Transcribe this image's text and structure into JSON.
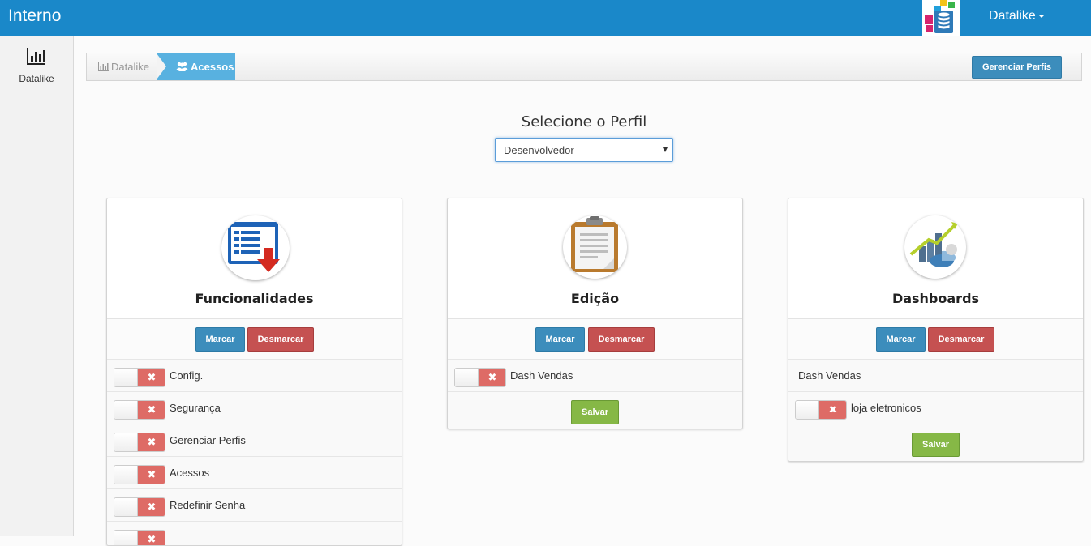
{
  "navbar": {
    "brand": "Interno",
    "user_menu_label": "Datalike"
  },
  "sidebar": {
    "items": [
      {
        "label": "Datalike",
        "icon": "bar-chart-icon"
      }
    ]
  },
  "breadcrumb": {
    "items": [
      {
        "label": "Datalike",
        "icon": "bar-chart-icon"
      },
      {
        "label": "Acessos",
        "icon": "users-icon"
      }
    ],
    "manage_profiles_label": "Gerenciar Perfis"
  },
  "profile_select": {
    "title": "Selecione o Perfil",
    "selected": "Desenvolvedor"
  },
  "cards": [
    {
      "title": "Funcionalidades",
      "icon": "list-download-icon",
      "mark_label": "Marcar",
      "unmark_label": "Desmarcar",
      "rows": [
        {
          "label": "Config.",
          "checked": false
        },
        {
          "label": "Segurança",
          "checked": false
        },
        {
          "label": "Gerenciar Perfis",
          "checked": false
        },
        {
          "label": "Acessos",
          "checked": false
        },
        {
          "label": "Redefinir Senha",
          "checked": false
        },
        {
          "label": "",
          "checked": false
        }
      ]
    },
    {
      "title": "Edição",
      "icon": "clipboard-icon",
      "mark_label": "Marcar",
      "unmark_label": "Desmarcar",
      "rows": [
        {
          "label": "Dash Vendas",
          "checked": false
        }
      ],
      "save_label": "Salvar"
    },
    {
      "title": "Dashboards",
      "icon": "dashboard-chart-icon",
      "mark_label": "Marcar",
      "unmark_label": "Desmarcar",
      "group_label": "Dash Vendas",
      "rows": [
        {
          "label": "loja eletronicos",
          "checked": false
        }
      ],
      "save_label": "Salvar"
    }
  ],
  "toggle_off_symbol": "✖",
  "colors": {
    "navbar": "#1a88c9",
    "primary_button": "#3c8dbc",
    "danger_button": "#c55151",
    "success_button": "#86b846",
    "toggle_off": "#de6b66"
  }
}
